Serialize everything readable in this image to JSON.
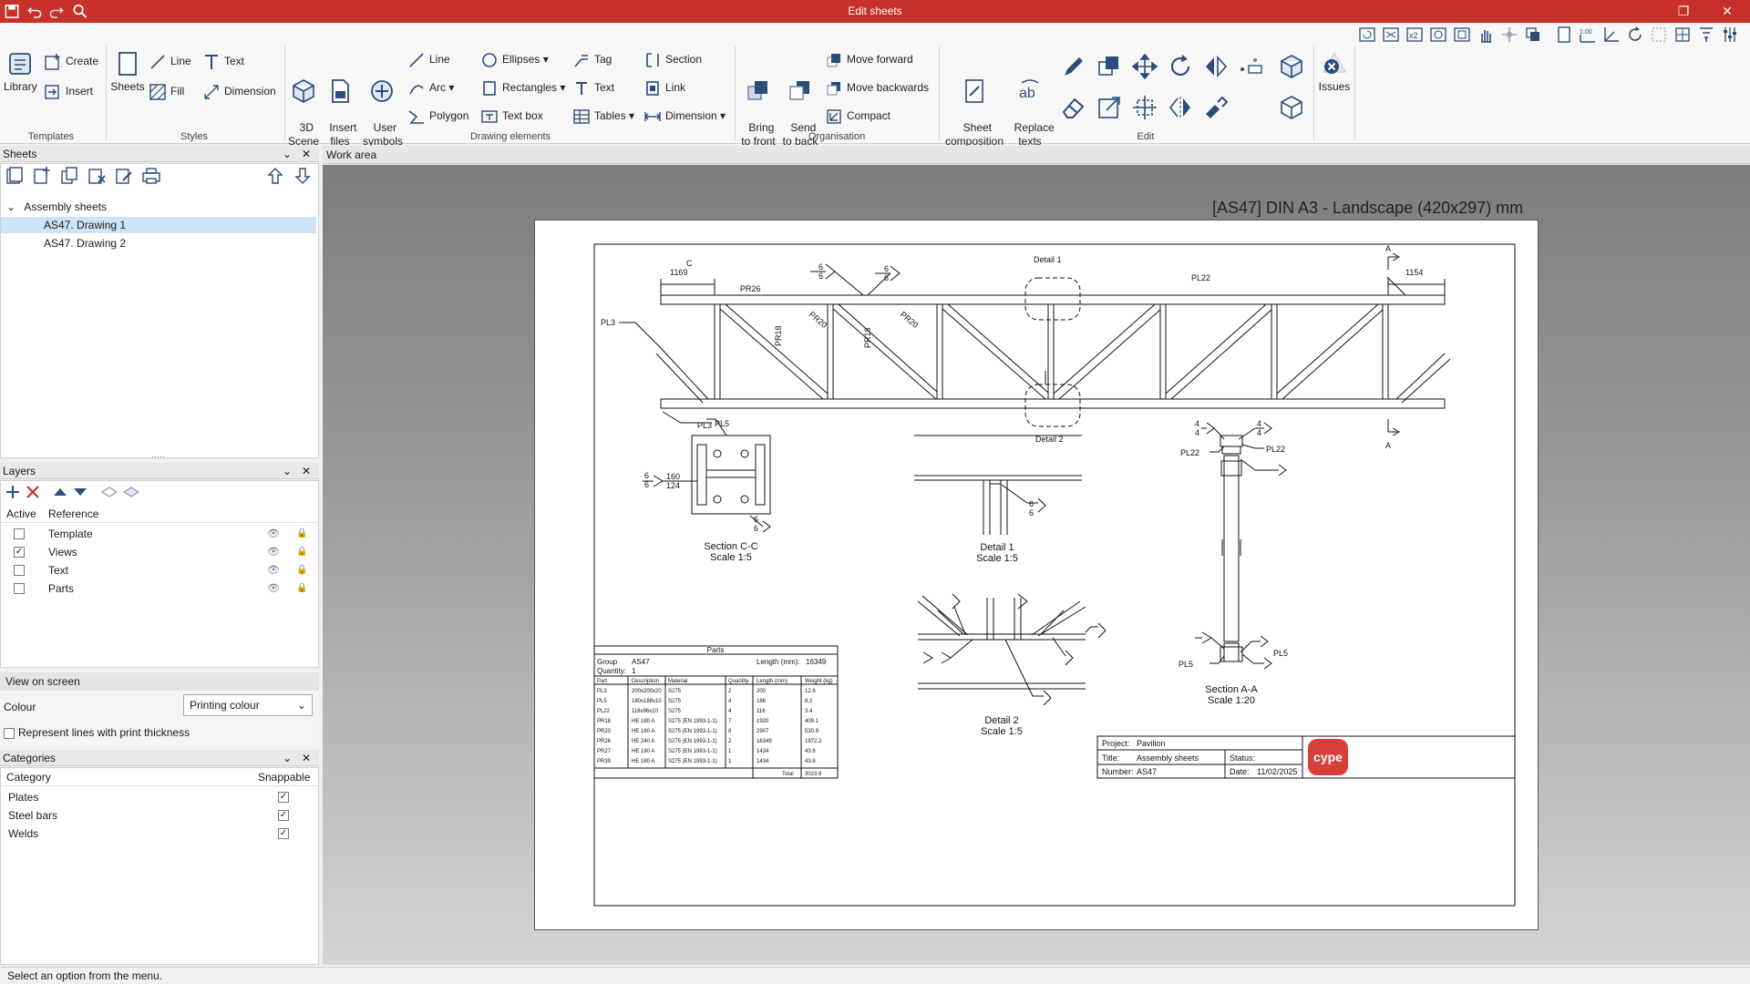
{
  "window": {
    "title": "Edit sheets"
  },
  "ribbon": {
    "templates": {
      "group_label": "Templates",
      "library": "Library",
      "create": "Create",
      "insert": "Insert"
    },
    "styles": {
      "group_label": "Styles",
      "sheets": "Sheets",
      "line": "Line",
      "text": "Text",
      "fill": "Fill",
      "dimension": "Dimension"
    },
    "drawing": {
      "group_label": "Drawing elements",
      "scene3d": "3D\nScene",
      "insert_files": "Insert\nfiles",
      "user_symbols": "User\nsymbols",
      "line": "Line",
      "arc": "Arc",
      "polygon": "Polygon",
      "ellipses": "Ellipses",
      "rectangles": "Rectangles",
      "text_box": "Text box",
      "tag": "Tag",
      "text": "Text",
      "tables": "Tables",
      "section": "Section",
      "link": "Link",
      "dimension": "Dimension"
    },
    "organisation": {
      "group_label": "Organisation",
      "bring_front": "Bring\nto front",
      "send_back": "Send\nto back",
      "move_forward": "Move forward",
      "move_backwards": "Move backwards",
      "compact": "Compact"
    },
    "edit": {
      "group_label": "Edit",
      "sheet_composition": "Sheet\ncomposition",
      "replace_texts": "Replace\ntexts",
      "issues": "Issues"
    }
  },
  "sheets_panel": {
    "title": "Sheets",
    "group": "Assembly sheets",
    "items": [
      "AS47. Drawing 1",
      "AS47. Drawing 2"
    ]
  },
  "layers_panel": {
    "title": "Layers",
    "col_active": "Active",
    "col_reference": "Reference",
    "rows": [
      {
        "name": "Template",
        "active": false
      },
      {
        "name": "Views",
        "active": true
      },
      {
        "name": "Text",
        "active": false
      },
      {
        "name": "Parts",
        "active": false
      }
    ]
  },
  "view_on_screen": {
    "title": "View on screen",
    "colour_label": "Colour",
    "colour_value": "Printing colour",
    "represent_lines": "Represent lines with print thickness"
  },
  "categories_panel": {
    "title": "Categories",
    "col_category": "Category",
    "col_snappable": "Snappable",
    "rows": [
      {
        "name": "Plates",
        "snappable": true
      },
      {
        "name": "Steel bars",
        "snappable": true
      },
      {
        "name": "Welds",
        "snappable": true
      }
    ]
  },
  "workarea": {
    "title": "Work area",
    "sheet_label": "[AS47] DIN A3 - Landscape (420x297) mm"
  },
  "drawing": {
    "dims": {
      "left": "1169",
      "right": "1154"
    },
    "labels": {
      "pr26": "PR26",
      "pr18a": "PR18",
      "pr20a": "PR20",
      "pr18b": "PR18",
      "pr20b": "PR20",
      "pl3": "PL3",
      "pl5": "PL5",
      "pl22": "PL22",
      "section_a": "A",
      "c_mark": "C",
      "detail1": "Detail 1",
      "detail2": "Detail 2",
      "weld": "6",
      "weld4": "4",
      "dim160": "160",
      "dim124": "124"
    },
    "section_cc": {
      "title": "Section C-C",
      "scale": "Scale 1:5"
    },
    "detail1_view": {
      "title": "Detail 1",
      "scale": "Scale 1:5"
    },
    "detail2_view": {
      "title": "Detail 2",
      "scale": "Scale 1:5"
    },
    "section_aa": {
      "title": "Section A-A",
      "scale": "Scale 1:20"
    }
  },
  "parts_table": {
    "title": "Parts",
    "group_label": "Group",
    "group_value": "AS47",
    "length_label": "Length (mm):",
    "length_value": "16349",
    "quantity_label": "Quantity:",
    "quantity_value": "1",
    "headers": [
      "Part",
      "Description",
      "Material",
      "Quantity",
      "Length (mm)",
      "Weight (kg)"
    ],
    "rows": [
      [
        "PL3",
        "200x200x20",
        "S275",
        "2",
        "200",
        "12.6"
      ],
      [
        "PL5",
        "180x188x10",
        "S275",
        "4",
        "186",
        "8.2"
      ],
      [
        "PL22",
        "116x96x10",
        "S275",
        "4",
        "116",
        "3.4"
      ],
      [
        "PR18",
        "HE 180 A",
        "S275 (EN 1993-1-1)",
        "7",
        "1920",
        "409.1"
      ],
      [
        "PR20",
        "HE 180 A",
        "S275 (EN 1993-1-1)",
        "8",
        "2907",
        "530.9"
      ],
      [
        "PR26",
        "HE 240 A",
        "S275 (EN 1993-1-1)",
        "2",
        "16349",
        "1972.2"
      ],
      [
        "PR27",
        "HE 180 A",
        "S275 (EN 1993-1-1)",
        "1",
        "1434",
        "43.6"
      ],
      [
        "PR39",
        "HE 180 A",
        "S275 (EN 1993-1-1)",
        "1",
        "1434",
        "43.6"
      ]
    ],
    "total_label": "Total",
    "total_value": "3023.6"
  },
  "title_block": {
    "project_label": "Project:",
    "project_value": "Pavilion",
    "title_label": "Title:",
    "title_value": "Assembly sheets",
    "status_label": "Status:",
    "status_value": "",
    "number_label": "Number:",
    "number_value": "AS47",
    "date_label": "Date:",
    "date_value": "11/02/2025",
    "logo": "cype"
  },
  "status": {
    "message": "Select an option from the menu."
  },
  "colors": {
    "titlebar": "#c8302a",
    "logo": "#d6403a",
    "selection": "#cde4f7"
  }
}
